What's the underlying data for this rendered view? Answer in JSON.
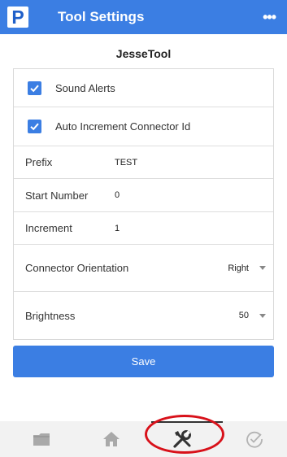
{
  "header": {
    "logo_letter": "P",
    "title": "Tool Settings",
    "more_label": "•••"
  },
  "tool_name": "JesseTool",
  "settings": {
    "sound_alerts": {
      "label": "Sound Alerts",
      "checked": true
    },
    "auto_increment": {
      "label": "Auto Increment Connector Id",
      "checked": true
    },
    "prefix": {
      "label": "Prefix",
      "value": "TEST"
    },
    "start_number": {
      "label": "Start Number",
      "value": "0"
    },
    "increment": {
      "label": "Increment",
      "value": "1"
    },
    "connector_orientation": {
      "label": "Connector Orientation",
      "value": "Right"
    },
    "brightness": {
      "label": "Brightness",
      "value": "50"
    }
  },
  "save_label": "Save",
  "bottom_nav": [
    {
      "icon": "folder-icon"
    },
    {
      "icon": "home-icon"
    },
    {
      "icon": "tools-icon",
      "active": true
    },
    {
      "icon": "check-circle-icon"
    }
  ],
  "colors": {
    "accent": "#3b7ee3",
    "annotation": "#d8111a"
  }
}
